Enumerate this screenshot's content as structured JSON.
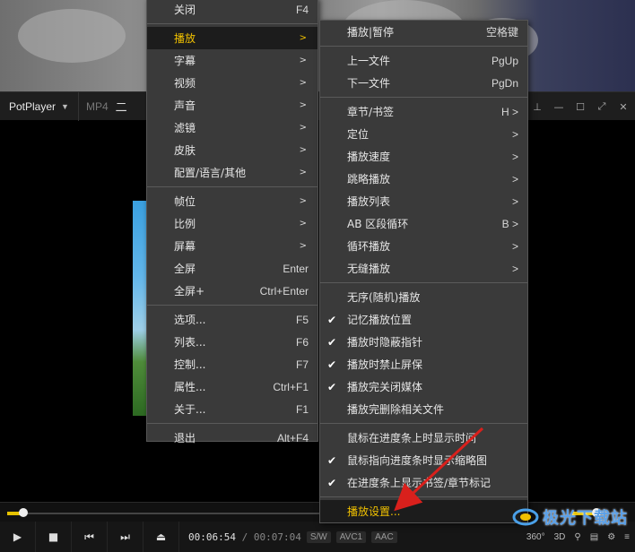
{
  "player": {
    "app_name": "PotPlayer",
    "format": "MP4",
    "file_name_partial": "二",
    "time_current": "00:06:54",
    "time_separator": "/",
    "time_total": "00:07:04",
    "badges": [
      "S/W",
      "AVC1",
      "AAC"
    ],
    "right_controls": [
      "360°",
      "3D"
    ],
    "progress_fraction": 0.05,
    "volume_fraction": 0.45
  },
  "main_menu": {
    "items": [
      {
        "label": "关闭",
        "shortcut": "F4"
      },
      {
        "label": "播放",
        "submenu": true,
        "selected": true
      },
      {
        "label": "字幕",
        "submenu": true
      },
      {
        "label": "视频",
        "submenu": true
      },
      {
        "label": "声音",
        "submenu": true
      },
      {
        "label": "滤镜",
        "submenu": true
      },
      {
        "label": "皮肤",
        "submenu": true
      },
      {
        "label": "配置/语言/其他",
        "submenu": true
      },
      {
        "label": "帧位",
        "submenu": true
      },
      {
        "label": "比例",
        "submenu": true
      },
      {
        "label": "屏幕",
        "submenu": true
      },
      {
        "label": "全屏",
        "shortcut": "Enter"
      },
      {
        "label": "全屏+",
        "shortcut": "Ctrl+Enter"
      },
      {
        "label": "选项...",
        "shortcut": "F5"
      },
      {
        "label": "列表...",
        "shortcut": "F6"
      },
      {
        "label": "控制...",
        "shortcut": "F7"
      },
      {
        "label": "属性...",
        "shortcut": "Ctrl+F1"
      },
      {
        "label": "关于...",
        "shortcut": "F1"
      },
      {
        "label": "退出",
        "shortcut": "Alt+F4"
      }
    ],
    "arrow": ">"
  },
  "play_submenu": {
    "items": [
      {
        "label": "播放|暂停",
        "shortcut": "空格键"
      },
      {
        "label": "上一文件",
        "shortcut": "PgUp"
      },
      {
        "label": "下一文件",
        "shortcut": "PgDn"
      },
      {
        "label": "章节/书签",
        "shortcut": "H >"
      },
      {
        "label": "定位",
        "shortcut": ">"
      },
      {
        "label": "播放速度",
        "shortcut": ">"
      },
      {
        "label": "跳略播放",
        "shortcut": ">"
      },
      {
        "label": "播放列表",
        "shortcut": ">"
      },
      {
        "label": "AB 区段循环",
        "shortcut": "B >"
      },
      {
        "label": "循环播放",
        "shortcut": ">"
      },
      {
        "label": "无缝播放",
        "shortcut": ">"
      },
      {
        "label": "无序(随机)播放",
        "checked": false
      },
      {
        "label": "记忆播放位置",
        "checked": true
      },
      {
        "label": "播放时隐蔽指针",
        "checked": true
      },
      {
        "label": "播放时禁止屏保",
        "checked": true
      },
      {
        "label": "播放完关闭媒体",
        "checked": true
      },
      {
        "label": "播放完删除相关文件",
        "checked": false
      },
      {
        "label": "鼠标在进度条上时显示时间",
        "checked": false
      },
      {
        "label": "鼠标指向进度条时显示缩略图",
        "checked": true
      },
      {
        "label": "在进度条上显示书签/章节标记",
        "checked": true
      },
      {
        "label": "播放设置...",
        "selected": true
      }
    ],
    "check_glyph": "✔"
  },
  "watermark": {
    "text": "极光下载站"
  },
  "colors": {
    "menu_bg": "#3a3a3a",
    "highlight_text": "#f0c000",
    "accent_yellow": "#e6c200",
    "annotation_red": "#d9201c"
  }
}
